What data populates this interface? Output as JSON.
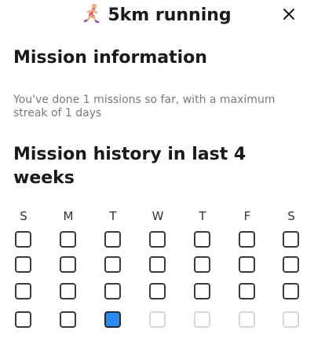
{
  "header": {
    "title": "5km running",
    "icon": "runner-icon",
    "close_icon": "close-icon"
  },
  "info": {
    "heading": "Mission information",
    "summary": "You've done 1 missions so far, with a maximum streak of 1 days"
  },
  "history": {
    "heading": "Mission history in last 4 weeks",
    "days": [
      "S",
      "M",
      "T",
      "W",
      "T",
      "F",
      "S"
    ],
    "weeks": [
      [
        "empty",
        "empty",
        "empty",
        "empty",
        "empty",
        "empty",
        "empty"
      ],
      [
        "empty",
        "empty",
        "empty",
        "empty",
        "empty",
        "empty",
        "empty"
      ],
      [
        "empty",
        "empty",
        "empty",
        "empty",
        "empty",
        "empty",
        "empty"
      ],
      [
        "empty",
        "empty",
        "done",
        "future",
        "future",
        "future",
        "future"
      ]
    ]
  },
  "colors": {
    "done": "#2a8cf0",
    "empty_border": "#3a3a3a",
    "future_border": "#d7d7d7",
    "summary_text": "#7a7a7a"
  }
}
